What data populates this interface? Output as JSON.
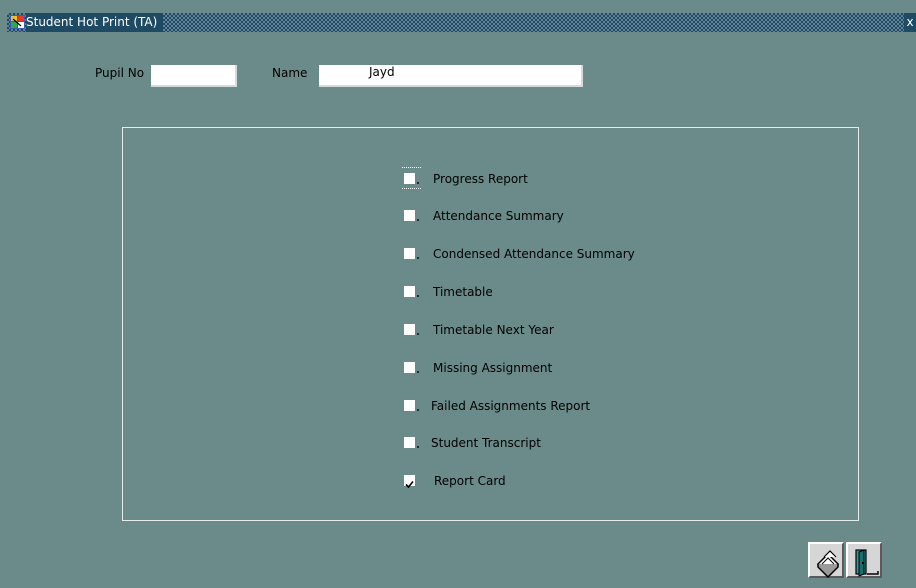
{
  "window": {
    "title": "Student Hot Print (TA)",
    "close_glyph": "x",
    "background_color": "#6a8b89",
    "titlebar_color": "#1f4a63"
  },
  "form": {
    "pupil_no_label": "Pupil No",
    "pupil_no_value": "",
    "name_label": "Name",
    "name_value": "Jayd"
  },
  "report_options": [
    {
      "label": "Progress Report",
      "checked": false
    },
    {
      "label": "Attendance Summary",
      "checked": false
    },
    {
      "label": "Condensed Attendance Summary",
      "checked": false
    },
    {
      "label": "Timetable",
      "checked": false
    },
    {
      "label": "Timetable Next Year",
      "checked": false
    },
    {
      "label": "Missing Assignment",
      "checked": false
    },
    {
      "label": "Failed Assignments Report",
      "checked": false
    },
    {
      "label": "Student Transcript",
      "checked": false
    },
    {
      "label": "Report Card",
      "checked": true
    }
  ],
  "toolbar": {
    "print_icon": "printer-icon",
    "exit_icon": "exit-door-icon"
  }
}
